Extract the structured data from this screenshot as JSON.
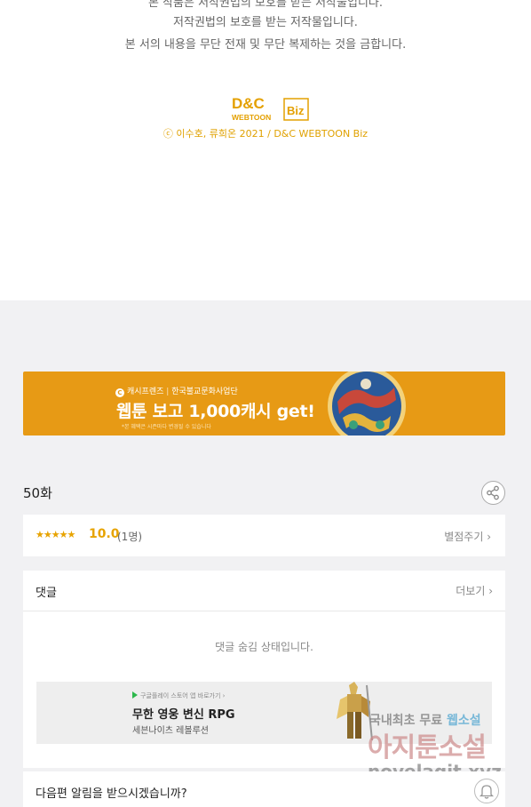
{
  "copyright_notice": {
    "line1": "본 작품은 저작권법의 보호를 받는 저작물입니다.",
    "line2": "저작권법의 보호를 받는 저작물입니다.",
    "line3": "본 서의 내용을 무단 전재 및 무단 복제하는 것을 금합니다."
  },
  "publisher": {
    "logo_top": "D&C",
    "logo_biz": "Biz",
    "logo_bottom": "WEBTOON",
    "copyright": "ⓒ 이수호, 류희온 2021 / D&C WEBTOON Biz"
  },
  "banner": {
    "brand": "캐시프렌즈",
    "org": "한국불교문화사업단",
    "headline": "웹툰 보고 1,000캐시 get!",
    "fine_print": "*본 혜택은 시즌마다 변경될 수 있습니다"
  },
  "episode": {
    "title": "50화"
  },
  "rating": {
    "stars": "★★★★★",
    "score": "10.0",
    "count": "(1명)",
    "give_label": "별점주기 ›"
  },
  "comments": {
    "heading": "댓글",
    "more_label": "더보기 ›",
    "hidden_message": "댓글 숨김 상태입니다."
  },
  "ad": {
    "store_label": "구글플레이 스토어 앱 바로가기 ›",
    "title": "무한 영웅 변신 RPG",
    "subtitle": "세븐나이츠 레볼루션"
  },
  "watermark": {
    "line1_prefix": "국내최초 무료",
    "line1_accent": "웹소설",
    "line2": "아지툰소설",
    "line3": "novelagit.xyz"
  },
  "notify": {
    "question": "다음편 알림을 받으시겠습니까?"
  },
  "colors": {
    "accent": "#e7a300",
    "banner_bg": "#e79a15",
    "page_bg": "#f1f1f3"
  },
  "icons": {
    "share": "share-icon",
    "bell": "bell-icon",
    "chevron": "chevron-right-icon"
  }
}
